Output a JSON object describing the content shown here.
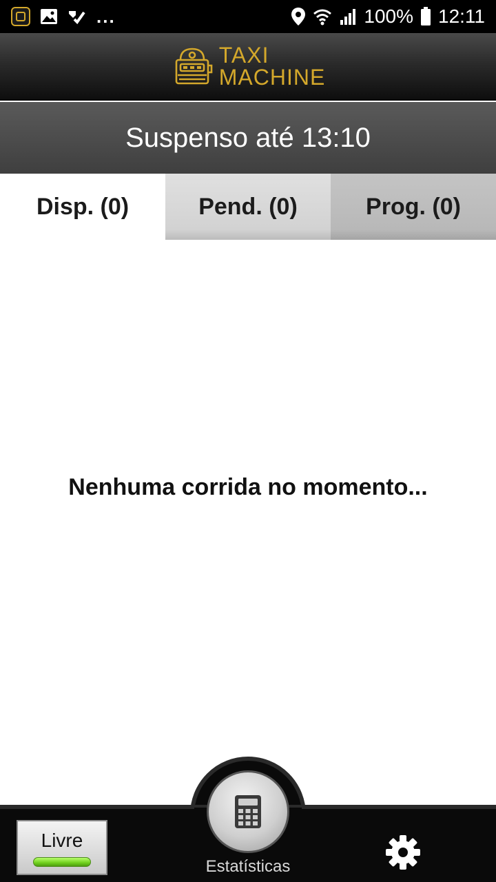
{
  "status_bar": {
    "dots": "...",
    "battery": "100%",
    "time": "12:11",
    "icons": [
      "app-notification-icon",
      "image-icon",
      "check-icon",
      "location-icon",
      "wifi-icon",
      "signal-icon",
      "battery-icon"
    ]
  },
  "header": {
    "logo_line1": "TAXI",
    "logo_line2": "MACHINE",
    "logo_color": "#d4a82b"
  },
  "banner": {
    "text": "Suspenso até 13:10"
  },
  "tabs": [
    {
      "label": "Disp. (0)",
      "active": true
    },
    {
      "label": "Pend. (0)",
      "active": false
    },
    {
      "label": "Prog. (0)",
      "active": false
    }
  ],
  "main": {
    "empty_message": "Nenhuma corrida no momento..."
  },
  "bottom": {
    "status_button": "Livre",
    "status_indicator_color": "#7ddc2a",
    "stats_label": "Estatísticas",
    "stats_icon": "calculator-icon",
    "settings_icon": "gear-icon"
  }
}
